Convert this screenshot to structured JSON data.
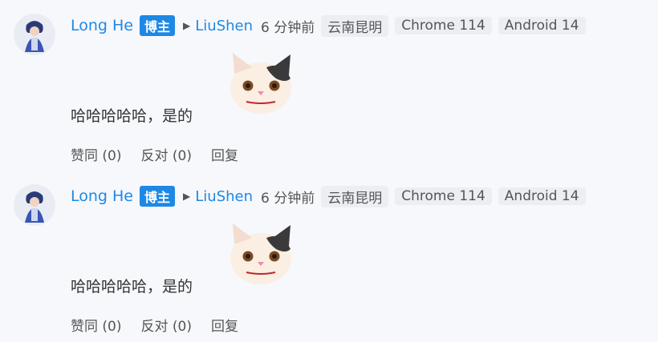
{
  "comments": [
    {
      "author": "Long He",
      "badge": "博主",
      "reply_to": "LiuShen",
      "time": "6 分钟前",
      "location": "云南昆明",
      "browser": "Chrome 114",
      "os": "Android 14",
      "text": "哈哈哈哈哈，是的",
      "sticker": "cat-sticker-icon",
      "actions": {
        "like": "赞同 (0)",
        "dislike": "反对 (0)",
        "reply": "回复"
      }
    },
    {
      "author": "Long He",
      "badge": "博主",
      "reply_to": "LiuShen",
      "time": "6 分钟前",
      "location": "云南昆明",
      "browser": "Chrome 114",
      "os": "Android 14",
      "text": "哈哈哈哈哈，是的",
      "sticker": "cat-sticker-icon",
      "actions": {
        "like": "赞同 (0)",
        "dislike": "反对 (0)",
        "reply": "回复"
      }
    }
  ],
  "colors": {
    "link": "#1e88e5",
    "badge_bg": "#1e88e5",
    "tag_bg": "#eceef3",
    "background": "#f7f8fc"
  }
}
